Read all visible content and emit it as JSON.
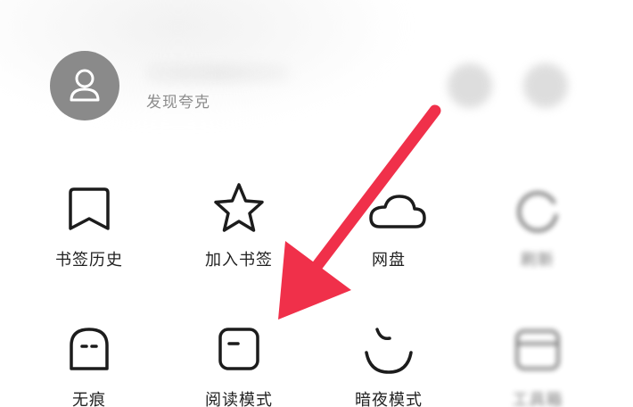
{
  "header": {
    "subtitle": "发现夸克",
    "icons": [
      "user-icon",
      "message-icon",
      "settings-icon"
    ]
  },
  "menu": {
    "row1": [
      {
        "label": "书签历史",
        "icon": "bookmark-icon"
      },
      {
        "label": "加入书签",
        "icon": "star-icon"
      },
      {
        "label": "网盘",
        "icon": "cloud-icon"
      },
      {
        "label": "刷新",
        "icon": "refresh-icon"
      }
    ],
    "row2": [
      {
        "label": "无痕",
        "icon": "ghost-icon"
      },
      {
        "label": "阅读模式",
        "icon": "reading-mode-icon"
      },
      {
        "label": "暗夜模式",
        "icon": "night-mode-icon"
      },
      {
        "label": "工具箱",
        "icon": "toolbox-icon"
      }
    ]
  },
  "annotation": {
    "arrow_color": "#f0304a",
    "points_to": "阅读模式"
  },
  "colors": {
    "icon_stroke": "#1c1c1c",
    "label_text": "#222222",
    "subtitle_text": "#8c8c8c",
    "avatar_bg": "#8a8a8a"
  }
}
